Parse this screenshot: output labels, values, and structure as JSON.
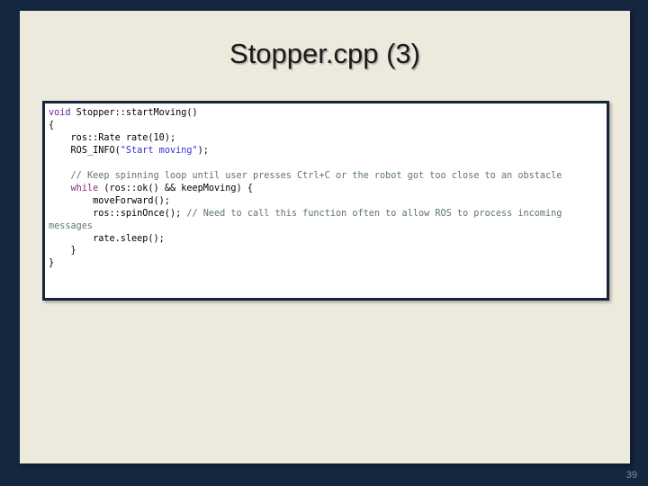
{
  "slide": {
    "title": "Stopper.cpp (3)",
    "page_number": "39",
    "colors": {
      "background": "#15263f",
      "panel": "#ece9dd",
      "code_box_background": "#ffffff",
      "code_box_border": "#16243c",
      "keyword": "#6f1f96",
      "keyword_control": "#8b2a7a",
      "string": "#3333cc",
      "comment": "#5d756c",
      "page_number": "#7f8c9e"
    }
  },
  "code_block": {
    "language": "cpp",
    "lines": [
      {
        "indent": 0,
        "tokens": [
          {
            "t": "void",
            "c": "kw"
          },
          {
            "t": " Stopper::startMoving()",
            "c": "plain"
          }
        ]
      },
      {
        "indent": 0,
        "tokens": [
          {
            "t": "{",
            "c": "plain"
          }
        ]
      },
      {
        "indent": 1,
        "tokens": [
          {
            "t": "ros::Rate rate(10);",
            "c": "plain"
          }
        ]
      },
      {
        "indent": 1,
        "tokens": [
          {
            "t": "ROS_INFO(",
            "c": "plain"
          },
          {
            "t": "\"Start moving\"",
            "c": "str"
          },
          {
            "t": ");",
            "c": "plain"
          }
        ]
      },
      {
        "indent": 0,
        "tokens": [
          {
            "t": "",
            "c": "plain"
          }
        ]
      },
      {
        "indent": 1,
        "tokens": [
          {
            "t": "// Keep spinning loop until user presses Ctrl+C or the robot got too close to an obstacle",
            "c": "cmt"
          }
        ]
      },
      {
        "indent": 1,
        "tokens": [
          {
            "t": "while",
            "c": "kw2"
          },
          {
            "t": " (ros::ok() && keepMoving) {",
            "c": "plain"
          }
        ]
      },
      {
        "indent": 2,
        "tokens": [
          {
            "t": "moveForward();",
            "c": "plain"
          }
        ]
      },
      {
        "indent": 2,
        "tokens": [
          {
            "t": "ros::spinOnce(); ",
            "c": "plain"
          },
          {
            "t": "// Need to call this function often to allow ROS to process incoming messages",
            "c": "cmt"
          }
        ]
      },
      {
        "indent": 2,
        "tokens": [
          {
            "t": "rate.sleep();",
            "c": "plain"
          }
        ]
      },
      {
        "indent": 1,
        "tokens": [
          {
            "t": "}",
            "c": "plain"
          }
        ]
      },
      {
        "indent": 0,
        "tokens": [
          {
            "t": "}",
            "c": "plain"
          }
        ]
      }
    ],
    "plain_text": "void Stopper::startMoving()\n{\n    ros::Rate rate(10);\n    ROS_INFO(\"Start moving\");\n\n    // Keep spinning loop until user presses Ctrl+C or the robot got too close to an obstacle\n    while (ros::ok() && keepMoving) {\n        moveForward();\n        ros::spinOnce(); // Need to call this function often to allow ROS to process incoming messages\n        rate.sleep();\n    }\n}"
  }
}
